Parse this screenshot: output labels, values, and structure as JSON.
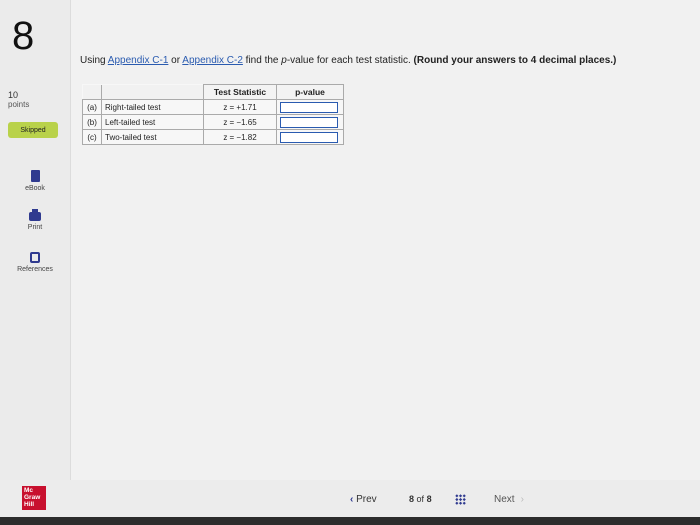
{
  "question_number": "8",
  "points": {
    "value": "10",
    "label": "points"
  },
  "status_badge": "Skipped",
  "tools": [
    {
      "label": "eBook",
      "icon": "book-icon"
    },
    {
      "label": "Print",
      "icon": "printer-icon"
    },
    {
      "label": "References",
      "icon": "references-icon"
    }
  ],
  "question": {
    "prefix": "Using ",
    "link1": "Appendix C-1",
    "middle": " or ",
    "link2": "Appendix C-2",
    "suffix": " find the ",
    "pvalue_word": "p",
    "suffix2": "-value for each test statistic. ",
    "bold": "(Round your answers to 4 decimal places.)"
  },
  "table": {
    "headers": {
      "stat": "Test Statistic",
      "pvalue": "p-value"
    },
    "rows": [
      {
        "label": "(a)",
        "desc": "Right-tailed test",
        "stat": "z = +1.71",
        "pvalue": ""
      },
      {
        "label": "(b)",
        "desc": "Left-tailed test",
        "stat": "z = −1.65",
        "pvalue": ""
      },
      {
        "label": "(c)",
        "desc": "Two-tailed test",
        "stat": "z = −1.82",
        "pvalue": ""
      }
    ]
  },
  "footer": {
    "logo": [
      "Mc",
      "Graw",
      "Hill"
    ],
    "prev": "Prev",
    "page_current": "8",
    "page_of": "of",
    "page_total": "8",
    "next": "Next"
  },
  "colors": {
    "accent": "#2f3a8f",
    "badge": "#b9d24a",
    "link": "#2a5bb0",
    "logo": "#c8102e"
  }
}
